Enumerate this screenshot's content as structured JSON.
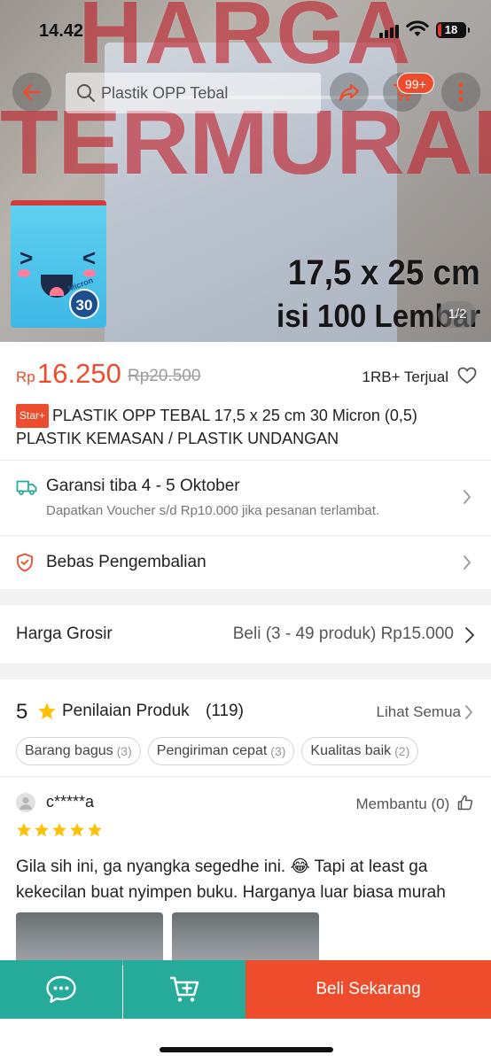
{
  "status_bar": {
    "time": "14.42",
    "battery": "18"
  },
  "hero": {
    "search_placeholder": "Plastik OPP Tebal",
    "cart_badge": "99+",
    "promo_line1": "HARGA",
    "promo_line2": "TERMURAH",
    "size_text": "17,5 x 25 cm",
    "qty_text": "isi 100 Lembar",
    "mascot_badge": "30",
    "mascot_caption": "Micron",
    "pager": "1/2"
  },
  "product": {
    "currency": "Rp",
    "price": "16.250",
    "old_price": "Rp20.500",
    "sold": "1RB+ Terjual",
    "badge": "Star+",
    "title": "PLASTIK OPP TEBAL 17,5 x 25 cm 30 Micron (0,5) PLASTIK KEMASAN / PLASTIK UNDANGAN"
  },
  "shipping": {
    "title": "Garansi tiba 4 - 5 Oktober",
    "subtitle": "Dapatkan Voucher s/d Rp10.000 jika pesanan terlambat."
  },
  "returns": {
    "title": "Bebas Pengembalian"
  },
  "wholesale": {
    "label": "Harga Grosir",
    "value": "Beli (3 - 49 produk) Rp15.000"
  },
  "ratings": {
    "score": "5",
    "label": "Penilaian Produk",
    "count": "(119)",
    "see_all": "Lihat Semua",
    "chips": [
      {
        "label": "Barang bagus",
        "count": "(3)"
      },
      {
        "label": "Pengiriman cepat",
        "count": "(3)"
      },
      {
        "label": "Kualitas baik",
        "count": "(2)"
      }
    ]
  },
  "review": {
    "user": "c*****a",
    "helpful": "Membantu (0)",
    "rating": 5,
    "line1": "Gila sih ini, ga nyangka segedhe ini. 😂 Tapi at least ga",
    "line2": "kekecilan buat nyimpen buku. Harganya luar biasa murah"
  },
  "bottom_bar": {
    "buy_label": "Beli Sekarang"
  },
  "colors": {
    "brand": "#ee4d2d",
    "teal": "#26aa99",
    "star": "#ffc107"
  }
}
